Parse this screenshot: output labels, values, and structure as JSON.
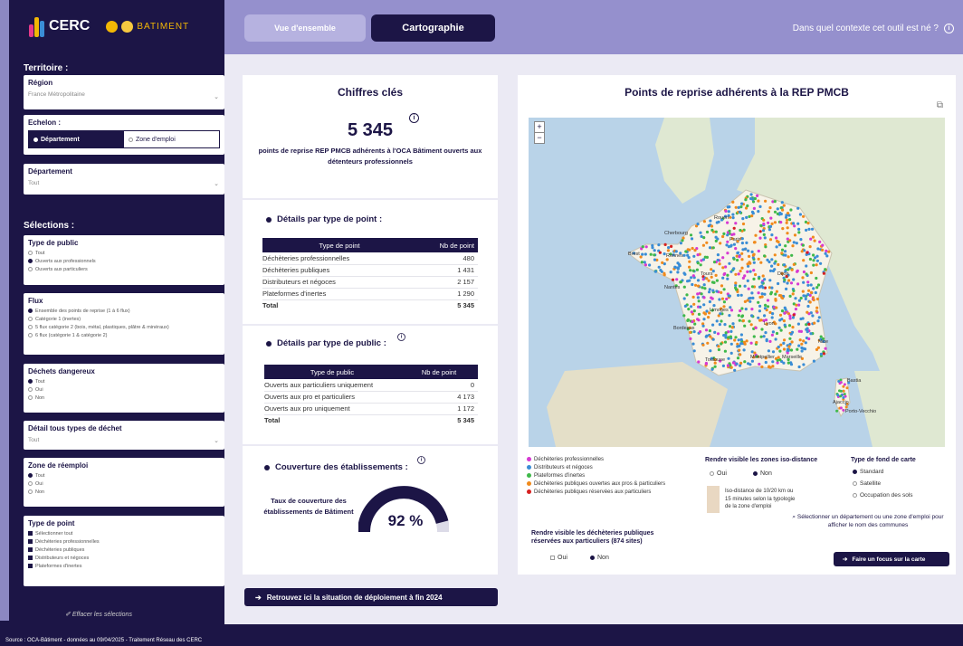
{
  "brand": {
    "cerc": "CERC",
    "oca": "BATIMENT"
  },
  "sidebar": {
    "territoire_heading": "Territoire :",
    "region": {
      "label": "Région",
      "value": "France Métropolitaine"
    },
    "echelon": {
      "label": "Echelon :",
      "opt1": "Département",
      "opt2": "Zone d'emploi"
    },
    "departement": {
      "label": "Département",
      "value": "Tout"
    },
    "selections_heading": "Sélections :",
    "type_public": {
      "label": "Type de public",
      "options": [
        "Tout",
        "Ouverts aux professionnels",
        "Ouverts aux particuliers"
      ]
    },
    "flux": {
      "label": "Flux",
      "options": [
        "Ensemble des points de reprise (1 à 6 flux)",
        "Catégorie 1 (inertes)",
        "5 flux catégorie 2 (bois, métal, plastiques, plâtre & minéraux)",
        "6 flux (catégorie 1 & catégorie 2)"
      ]
    },
    "dechets": {
      "label": "Déchets dangereux",
      "options": [
        "Tout",
        "Oui",
        "Non"
      ]
    },
    "detail": {
      "label": "Détail tous types de déchet",
      "value": "Tout"
    },
    "reemploi": {
      "label": "Zone de réemploi",
      "options": [
        "Tout",
        "Oui",
        "Non"
      ]
    },
    "type_point": {
      "label": "Type de point",
      "options": [
        "Sélectionner tout",
        "Déchèteries professionnelles",
        "Déchèteries publiques",
        "Distributeurs et négoces",
        "Plateformes d'inertes"
      ]
    },
    "clear": "Effacer les sélections"
  },
  "topbar": {
    "tab1": "Vue d'ensemble",
    "tab2": "Cartographie",
    "context": "Dans quel contexte cet outil est né ?"
  },
  "kpi": {
    "title": "Chiffres clés",
    "number": "5 345",
    "text": "points de reprise REP PMCB adhérents à l'OCA Bâtiment ouverts aux détenteurs professionnels"
  },
  "table1": {
    "heading": "Détails par type de point :",
    "headers": [
      "Type de point",
      "Nb de point"
    ],
    "rows": [
      [
        "Déchèteries professionnelles",
        "480"
      ],
      [
        "Déchèteries publiques",
        "1 431"
      ],
      [
        "Distributeurs et négoces",
        "2 157"
      ],
      [
        "Plateformes d'inertes",
        "1 290"
      ]
    ],
    "total": [
      "Total",
      "5 345"
    ]
  },
  "table2": {
    "heading": "Détails par type de public :",
    "headers": [
      "Type de public",
      "Nb de point"
    ],
    "rows": [
      [
        "Ouverts aux particuliers uniquement",
        "0"
      ],
      [
        "Ouverts aux pro et particuliers",
        "4 173"
      ],
      [
        "Ouverts aux pro uniquement",
        "1 172"
      ]
    ],
    "total": [
      "Total",
      "5 345"
    ]
  },
  "coverage": {
    "heading": "Couverture des établissements :",
    "label": "Taux de couverture des établissements de Bâtiment",
    "value_text": "92 %",
    "value": 0.92
  },
  "map": {
    "title": "Points de reprise adhérents à la REP PMCB",
    "zoom_in": "+",
    "zoom_out": "−",
    "legend": [
      {
        "label": "Déchèteries professionnelles",
        "color": "#d63ad2"
      },
      {
        "label": "Distributeurs et négoces",
        "color": "#3a8dd6"
      },
      {
        "label": "Plateformes d'inertes",
        "color": "#3fb94a"
      },
      {
        "label": "Déchèteries publiques ouvertes aux pros & particuliers",
        "color": "#f08a1c"
      },
      {
        "label": "Déchèteries publiques réservées aux particuliers",
        "color": "#d62020"
      }
    ],
    "iso": {
      "heading": "Rendre visible les zones iso-distance",
      "oui": "Oui",
      "non": "Non",
      "note": "Iso-distance de 10/20 km ou 15 minutes selon la typologie de la zone d'emploi"
    },
    "fond": {
      "heading": "Type de fond de carte",
      "options": [
        "Standard",
        "Satellite",
        "Occupation des sols"
      ]
    },
    "hint": "Sélectionner un département ou une zone d'emploi pour afficher le nom des communes",
    "particuliers": {
      "heading": "Rendre visible les déchèteries publiques réservées aux particuliers (874 sites)",
      "oui": "Oui",
      "non": "Non"
    },
    "focus_button": "Faire un focus sur la carte",
    "cities": [
      "Cherbourg",
      "Rouen",
      "Brest",
      "Paris",
      "Rennes",
      "Nantes",
      "Tours",
      "Dijon",
      "Limoges",
      "Bordeaux",
      "Lyon",
      "Toulouse",
      "Montpellier",
      "Nice",
      "Marseille",
      "Bastia",
      "Ajaccio",
      "Porto-Vecchio"
    ]
  },
  "footer": {
    "button": "Retrouvez ici la situation de déploiement à fin 2024",
    "source": "Source : OCA-Bâtiment - données au 09/04/2025 - Traitement Réseau des CERC"
  }
}
